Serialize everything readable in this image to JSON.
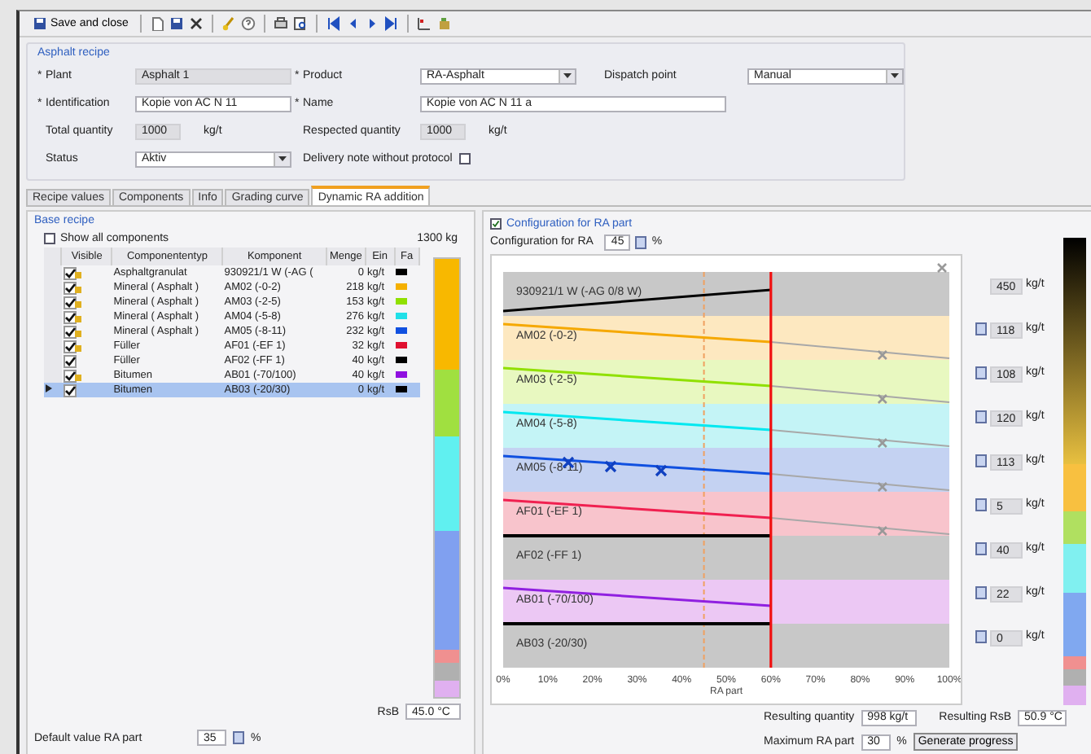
{
  "toolbar": {
    "save_close": "Save and close"
  },
  "recipe": {
    "title": "Asphalt recipe",
    "rows": [
      [
        {
          "required_mark": "*",
          "label": "Plant",
          "kind": "readonly",
          "value": "Asphalt 1"
        },
        {
          "required_mark": "*",
          "label": "Product",
          "kind": "combo",
          "value": "RA-Asphalt"
        },
        {
          "label": "Dispatch point",
          "kind": "combo",
          "value": "Manual"
        }
      ],
      [
        {
          "required_mark": "*",
          "label": "Identification",
          "kind": "text",
          "value": "Kopie von AC N 11"
        },
        {
          "required_mark": "*",
          "label": "Name",
          "kind": "text",
          "value": "Kopie von AC N 11 a"
        }
      ],
      [
        {
          "label": "Total quantity",
          "kind": "readonly",
          "value": "1000",
          "unit": "kg/t"
        },
        {
          "label": "Respected quantity",
          "kind": "readonly",
          "value": "1000",
          "unit": "kg/t"
        }
      ],
      [
        {
          "label": "Status",
          "kind": "combo",
          "value": "Aktiv"
        },
        {
          "label": "Delivery note without protocol",
          "kind": "checkbox",
          "checked": false
        }
      ]
    ]
  },
  "tabs": [
    {
      "label": "Recipe values",
      "selected": false
    },
    {
      "label": "Components",
      "selected": false
    },
    {
      "label": "Info",
      "selected": false
    },
    {
      "label": "Grading curve",
      "selected": false
    },
    {
      "label": "Dynamic RA addition",
      "selected": true
    }
  ],
  "base_recipe": {
    "title": "Base recipe",
    "show_all": {
      "label": "Show all components",
      "checked": false
    },
    "total": "1300 kg",
    "columns": [
      "Visible",
      "Componententyp",
      "Komponent",
      "Menge",
      "Ein",
      "Fa"
    ],
    "rows": [
      {
        "visible": true,
        "badge": true,
        "type": "Asphaltgranulat",
        "component": "930921/1 W (-AG (",
        "amount": "0",
        "unit": "kg/t",
        "color": "#000000",
        "selected": false
      },
      {
        "visible": true,
        "badge": true,
        "type": "Mineral ( Asphalt )",
        "component": "AM02 (-0-2)",
        "amount": "218",
        "unit": "kg/t",
        "color": "#f5b000",
        "selected": false
      },
      {
        "visible": true,
        "badge": true,
        "type": "Mineral ( Asphalt )",
        "component": "AM03 (-2-5)",
        "amount": "153",
        "unit": "kg/t",
        "color": "#90e000",
        "selected": false
      },
      {
        "visible": true,
        "badge": true,
        "type": "Mineral ( Asphalt )",
        "component": "AM04 (-5-8)",
        "amount": "276",
        "unit": "kg/t",
        "color": "#20e0e8",
        "selected": false
      },
      {
        "visible": true,
        "badge": true,
        "type": "Mineral ( Asphalt )",
        "component": "AM05 (-8-11)",
        "amount": "232",
        "unit": "kg/t",
        "color": "#1050e0",
        "selected": false
      },
      {
        "visible": true,
        "badge": true,
        "type": "Füller",
        "component": "AF01 (-EF 1)",
        "amount": "32",
        "unit": "kg/t",
        "color": "#e01030",
        "selected": false
      },
      {
        "visible": true,
        "badge": false,
        "type": "Füller",
        "component": "AF02 (-FF 1)",
        "amount": "40",
        "unit": "kg/t",
        "color": "#000000",
        "selected": false
      },
      {
        "visible": true,
        "badge": true,
        "type": "Bitumen",
        "component": "AB01 (-70/100)",
        "amount": "40",
        "unit": "kg/t",
        "color": "#9010e0",
        "selected": false
      },
      {
        "visible": true,
        "badge": false,
        "type": "Bitumen",
        "component": "AB03 (-20/30)",
        "amount": "0",
        "unit": "kg/t",
        "color": "#000000",
        "selected": true
      }
    ],
    "rsb_label": "RsB",
    "rsb": "45.0 °C",
    "default_label": "Default value RA part",
    "default_value": "35",
    "default_unit": "%"
  },
  "ra_config": {
    "title": "Configuration for RA part",
    "checked": true,
    "config_label": "Configuration for RA",
    "config_value": "45",
    "config_unit": "%",
    "bands": [
      {
        "label": "930921/1 W (-AG 0/8 W)",
        "color": "#c8c8c8",
        "line": {
          "color": "#000000"
        },
        "value": "450",
        "unit": "kg/t",
        "spinner": false
      },
      {
        "label": "AM02 (-0-2)",
        "color": "#fde8c0",
        "line": {
          "color": "#f5a800"
        },
        "value": "118",
        "unit": "kg/t",
        "spinner": true
      },
      {
        "label": "AM03 (-2-5)",
        "color": "#e8f8c0",
        "line": {
          "color": "#90e000"
        },
        "value": "108",
        "unit": "kg/t",
        "spinner": true
      },
      {
        "label": "AM04 (-5-8)",
        "color": "#c4f4f6",
        "line": {
          "color": "#00e8f0"
        },
        "value": "120",
        "unit": "kg/t",
        "spinner": true
      },
      {
        "label": "AM05 (-8-11)",
        "color": "#c4d2f2",
        "line": {
          "color": "#1050e0"
        },
        "value": "113",
        "unit": "kg/t",
        "spinner": true
      },
      {
        "label": "AF01 (-EF 1)",
        "color": "#f8c4cc",
        "line": {
          "color": "#f02050"
        },
        "value": "5",
        "unit": "kg/t",
        "spinner": true
      },
      {
        "label": "AF02 (-FF 1)",
        "color": "#c8c8c8",
        "line": {
          "color": "#000000"
        },
        "value": "40",
        "unit": "kg/t",
        "spinner": true
      },
      {
        "label": "AB01 (-70/100)",
        "color": "#ecc8f4",
        "line": {
          "color": "#9020e0"
        },
        "value": "22",
        "unit": "kg/t",
        "spinner": true
      },
      {
        "label": "AB03 (-20/30)",
        "color": "#c8c8c8",
        "line": {
          "color": "#000000"
        },
        "value": "0",
        "unit": "kg/t",
        "spinner": true
      }
    ],
    "x_ticks": [
      "0%",
      "10%",
      "20%",
      "30%",
      "40%",
      "50%",
      "60%",
      "70%",
      "80%",
      "90%",
      "100%"
    ],
    "xlabel": "RA part",
    "resulting_quantity_label": "Resulting quantity",
    "resulting_quantity": "998 kg/t",
    "resulting_rsb_label": "Resulting RsB",
    "resulting_rsb": "50.9 °C",
    "max_label": "Maximum RA part",
    "max_value": "30",
    "max_unit": "%",
    "generate_button": "Generate progress"
  }
}
